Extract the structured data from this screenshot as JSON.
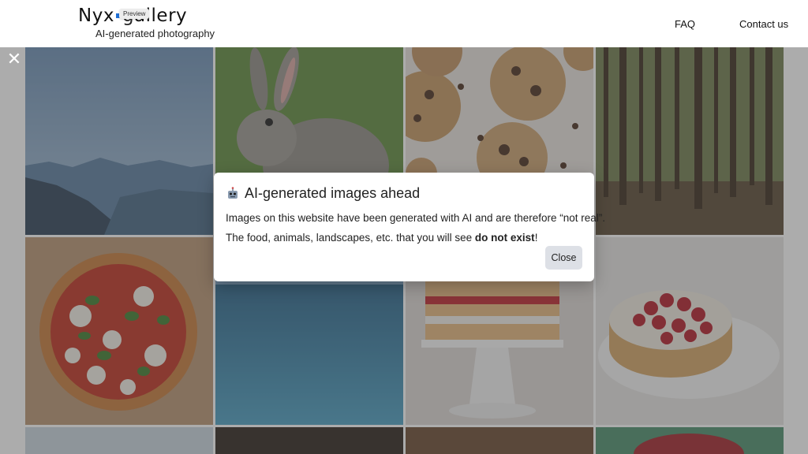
{
  "header": {
    "logo_text_left": "Nyx",
    "logo_text_right": "allery",
    "preview_tag": "Preview",
    "tagline": "AI-generated photography",
    "nav": [
      {
        "label": "FAQ"
      },
      {
        "label": "Contact us"
      }
    ]
  },
  "overlay": {
    "close_symbol": "✕"
  },
  "modal": {
    "title_icon": "robot-icon",
    "title": "AI-generated images ahead",
    "line1": "Images on this website have been generated with AI and are therefore “not real”.",
    "line2_prefix": "The food, animals, landscapes, etc. that you will see ",
    "line2_bold": "do not exist",
    "line2_suffix": "!",
    "close_button": "Close"
  },
  "gallery": {
    "images": [
      {
        "subject": "mountains-at-dusk"
      },
      {
        "subject": "rabbit"
      },
      {
        "subject": "chocolate-chip-cookies"
      },
      {
        "subject": "pine-forest"
      },
      {
        "subject": "pizza"
      },
      {
        "subject": "ocean"
      },
      {
        "subject": "layer-cake"
      },
      {
        "subject": "raspberry-tart"
      },
      {
        "subject": "sky"
      },
      {
        "subject": "starry-night"
      },
      {
        "subject": "brown-backdrop"
      },
      {
        "subject": "fruit-plate"
      }
    ]
  },
  "colors": {
    "logo_accent": "#1f6fd6",
    "overlay": "#464646",
    "button_bg": "#dde0e6"
  }
}
